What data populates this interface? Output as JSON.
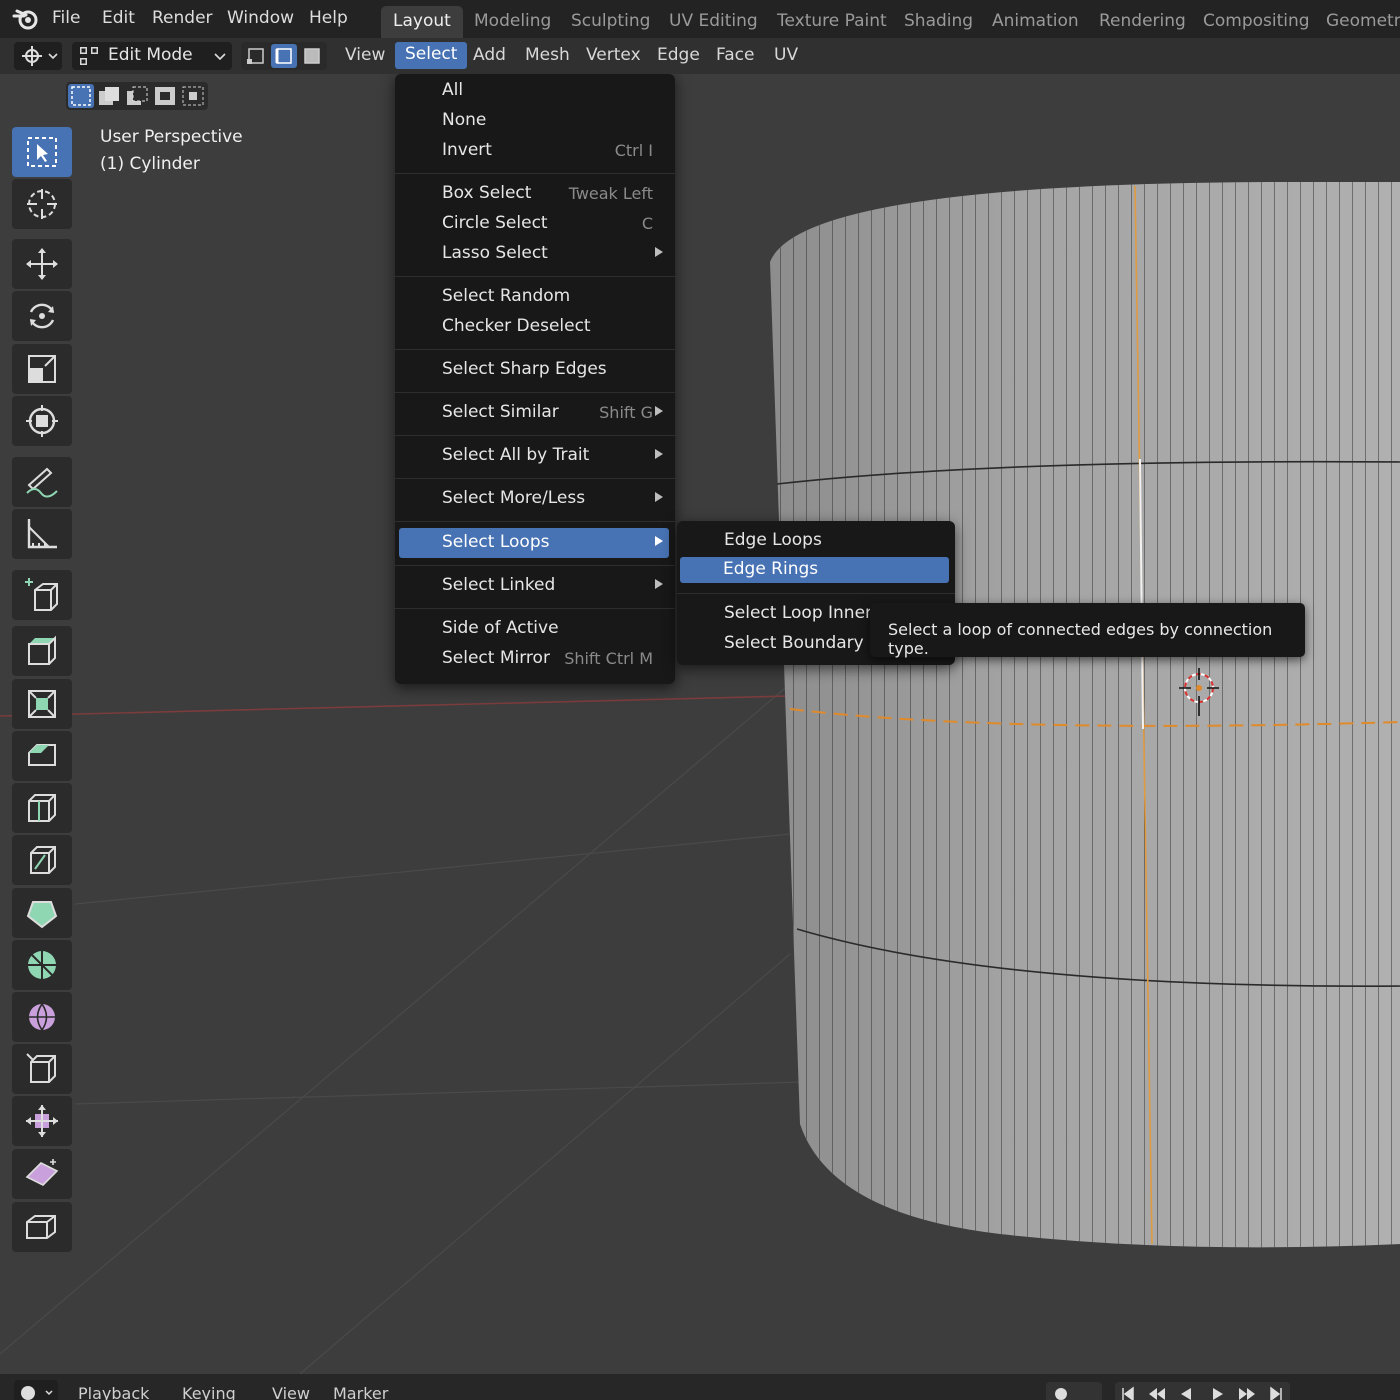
{
  "topbar": {
    "menus": [
      "File",
      "Edit",
      "Render",
      "Window",
      "Help"
    ],
    "workspaces": [
      "Layout",
      "Modeling",
      "Sculpting",
      "UV Editing",
      "Texture Paint",
      "Shading",
      "Animation",
      "Rendering",
      "Compositing",
      "Geometry"
    ]
  },
  "header": {
    "mode": "Edit Mode",
    "menus": [
      "View",
      "Select",
      "Add",
      "Mesh",
      "Vertex",
      "Edge",
      "Face",
      "UV"
    ]
  },
  "viewport": {
    "perspective": "User Perspective",
    "object": "(1) Cylinder"
  },
  "select_menu": {
    "items": [
      {
        "label": "All",
        "shortcut": "",
        "submenu": false
      },
      {
        "label": "None",
        "shortcut": "",
        "submenu": false
      },
      {
        "label": "Invert",
        "shortcut": "Ctrl I",
        "submenu": false
      },
      {
        "label": "Box Select",
        "shortcut": "Tweak Left",
        "submenu": false
      },
      {
        "label": "Circle Select",
        "shortcut": "C",
        "submenu": false
      },
      {
        "label": "Lasso Select",
        "shortcut": "",
        "submenu": true
      },
      {
        "label": "Select Random",
        "shortcut": "",
        "submenu": false
      },
      {
        "label": "Checker Deselect",
        "shortcut": "",
        "submenu": false
      },
      {
        "label": "Select Sharp Edges",
        "shortcut": "",
        "submenu": false
      },
      {
        "label": "Select Similar",
        "shortcut": "Shift G",
        "submenu": true
      },
      {
        "label": "Select All by Trait",
        "shortcut": "",
        "submenu": true
      },
      {
        "label": "Select More/Less",
        "shortcut": "",
        "submenu": true
      },
      {
        "label": "Select Loops",
        "shortcut": "",
        "submenu": true
      },
      {
        "label": "Select Linked",
        "shortcut": "",
        "submenu": true
      },
      {
        "label": "Side of Active",
        "shortcut": "",
        "submenu": false
      },
      {
        "label": "Select Mirror",
        "shortcut": "Shift Ctrl M",
        "submenu": false
      }
    ]
  },
  "loops_submenu": {
    "items": [
      "Edge Loops",
      "Edge Rings",
      "Select Loop Inner-R",
      "Select Boundary Lo"
    ]
  },
  "tooltip": {
    "text": "Select a loop of connected edges by connection type."
  },
  "bottombar": {
    "items": [
      "Playback",
      "Keying",
      "View",
      "Marker"
    ]
  },
  "colors": {
    "accent": "#4772b3",
    "menu_bg": "#181818",
    "viewport_bg": "#3d3d3d"
  }
}
